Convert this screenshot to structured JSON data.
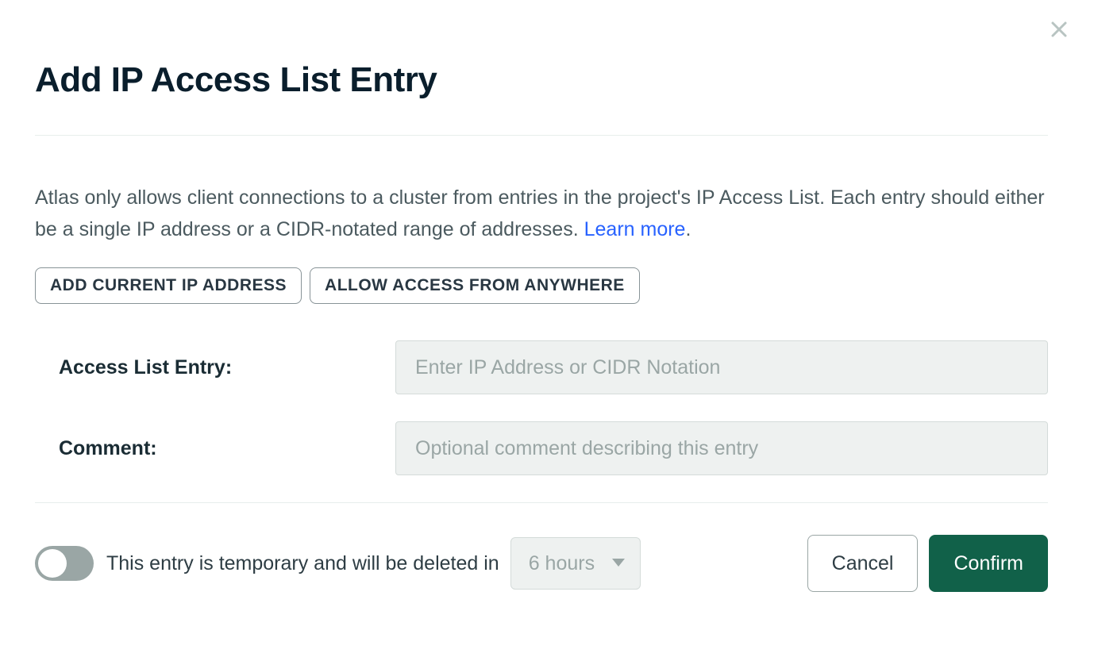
{
  "modal": {
    "title": "Add IP Access List Entry",
    "description_text": "Atlas only allows client connections to a cluster from entries in the project's IP Access List. Each entry should either be a single IP address or a CIDR-notated range of addresses. ",
    "learn_more": "Learn more",
    "shortcuts": {
      "add_current_ip": "ADD CURRENT IP ADDRESS",
      "allow_anywhere": "ALLOW ACCESS FROM ANYWHERE"
    },
    "form": {
      "entry_label": "Access List Entry:",
      "entry_placeholder": "Enter IP Address or CIDR Notation",
      "entry_value": "",
      "comment_label": "Comment:",
      "comment_placeholder": "Optional comment describing this entry",
      "comment_value": ""
    },
    "temporary": {
      "toggle_on": false,
      "label": "This entry is temporary and will be deleted in",
      "selected": "6 hours"
    },
    "actions": {
      "cancel": "Cancel",
      "confirm": "Confirm"
    }
  },
  "colors": {
    "accent_green": "#116149",
    "link_blue": "#2862ff"
  }
}
